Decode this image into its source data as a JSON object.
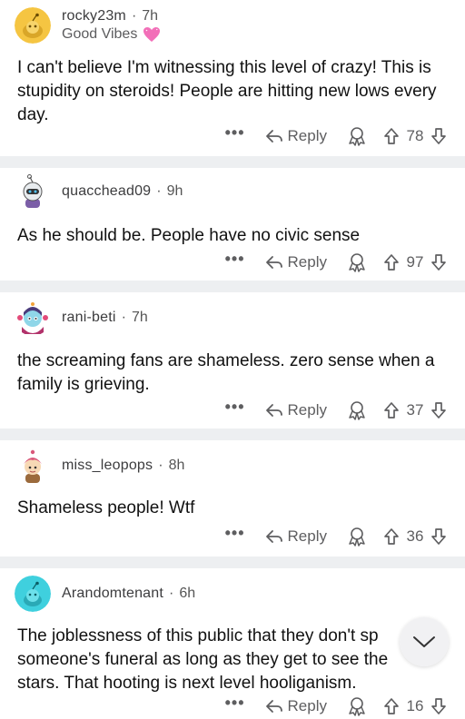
{
  "comments": [
    {
      "author": "rocky23m",
      "time": "7h",
      "flair": "Good Vibes",
      "body": "I can't believe I'm witnessing this level of crazy! This is stupidity on steroids! People are hitting new lows every day.",
      "reply_label": "Reply",
      "score": "78",
      "avatar_color": "#f5c542"
    },
    {
      "author": "quacchead09",
      "time": "9h",
      "body": "As he should be. People have no civic sense",
      "reply_label": "Reply",
      "score": "97",
      "avatar_color": "#ffffff"
    },
    {
      "author": "rani-beti",
      "time": "7h",
      "body": "the screaming fans are shameless. zero sense when a family is grieving.",
      "reply_label": "Reply",
      "score": "37",
      "avatar_color": "#ffffff"
    },
    {
      "author": "miss_leopops",
      "time": "8h",
      "body": "Shameless people! Wtf",
      "reply_label": "Reply",
      "score": "36",
      "avatar_color": "#ffffff"
    },
    {
      "author": "Arandomtenant",
      "time": "6h",
      "body": "The joblessness of this public that they don't sp someone's funeral as long as they get to see the stars. That hooting is next level hooliganism.",
      "reply_label": "Reply",
      "score": "16",
      "avatar_color": "#3fd0de"
    }
  ],
  "ui": {
    "dot": "·",
    "more": "•••",
    "scroll_icon": "chevron-down-icon"
  }
}
